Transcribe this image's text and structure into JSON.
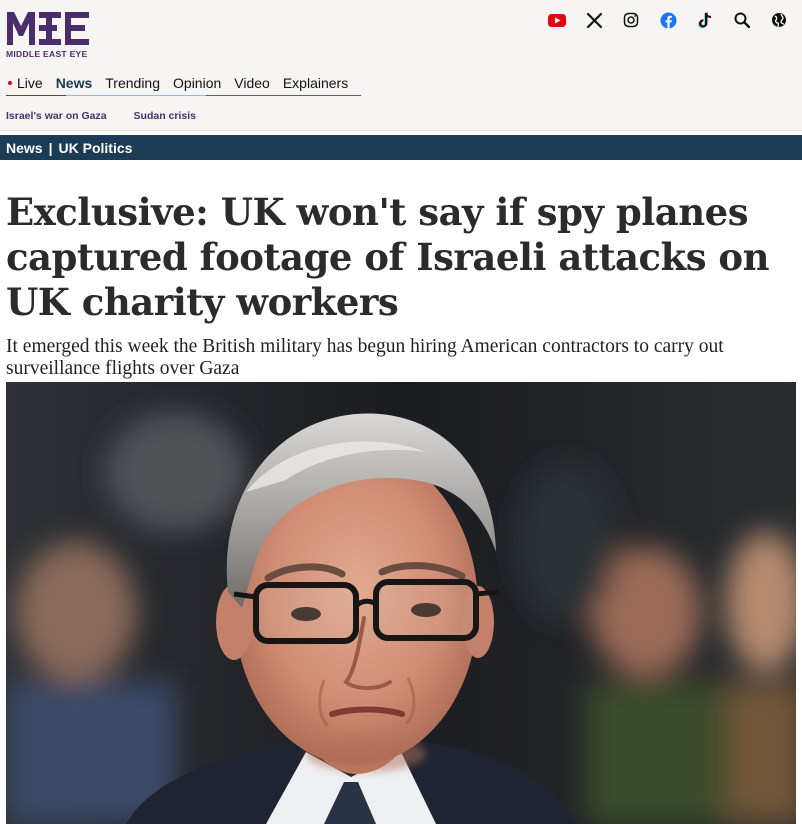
{
  "brand": {
    "logo_text": "MEE",
    "tagline": "MIDDLE EAST EYE",
    "logo_color": "#4b2d6b"
  },
  "social_icons": [
    {
      "name": "youtube-icon",
      "color": "#e30613"
    },
    {
      "name": "x-icon",
      "color": "#111111"
    },
    {
      "name": "instagram-icon",
      "color": "#111111"
    },
    {
      "name": "facebook-icon",
      "color": "#1877f2"
    },
    {
      "name": "tiktok-icon",
      "color": "#111111"
    },
    {
      "name": "search-icon",
      "color": "#111111"
    },
    {
      "name": "globe-icon",
      "color": "#111111"
    }
  ],
  "nav": {
    "items": [
      {
        "label": "Live",
        "live": true
      },
      {
        "label": "News",
        "active": true
      },
      {
        "label": "Trending"
      },
      {
        "label": "Opinion"
      },
      {
        "label": "Video"
      },
      {
        "label": "Explainers"
      }
    ]
  },
  "subnav": {
    "items": [
      "Israel's war on Gaza",
      "Sudan crisis"
    ]
  },
  "section": {
    "primary": "News",
    "separator": "|",
    "secondary": "UK Politics",
    "bar_color": "#1b3c54"
  },
  "article": {
    "headline": "Exclusive: UK won't say if spy planes captured footage of Israeli attacks on UK charity workers",
    "standfirst": "It emerged this week the British military has begun hiring American contractors to carry out surveillance flights over Gaza"
  }
}
